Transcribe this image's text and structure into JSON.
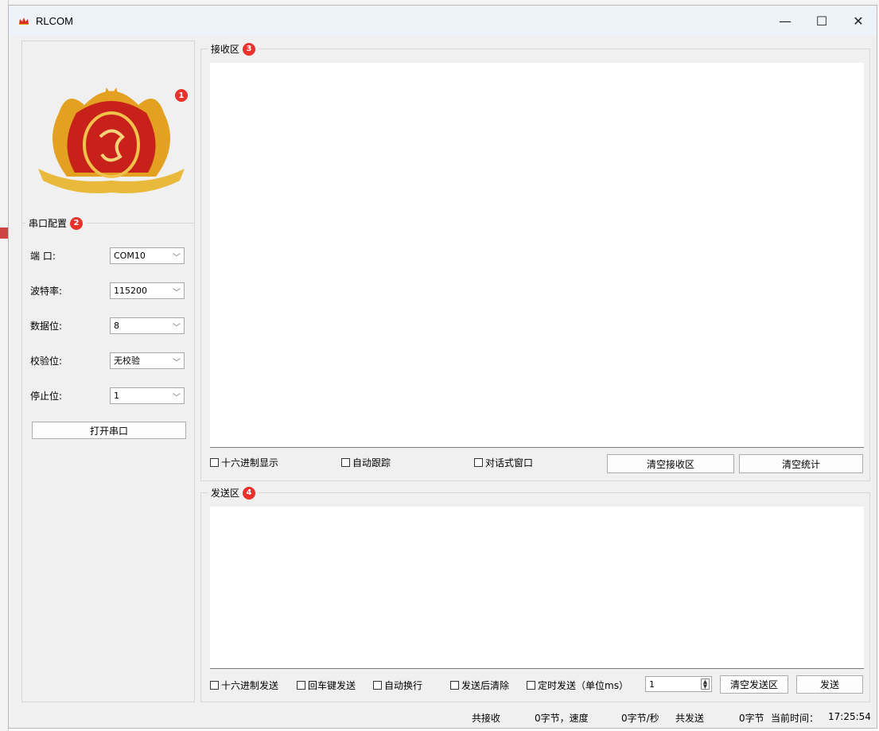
{
  "window": {
    "title": "RLCOM",
    "minimize": "—",
    "maximize": "☐",
    "close": "✕"
  },
  "logo": {
    "badge": "1"
  },
  "serial_config": {
    "title": "串口配置",
    "badge": "2",
    "rows": [
      {
        "label": "端  口:",
        "value": "COM10"
      },
      {
        "label": "波特率:",
        "value": "115200"
      },
      {
        "label": "数据位:",
        "value": "8"
      },
      {
        "label": "校验位:",
        "value": "无校验"
      },
      {
        "label": "停止位:",
        "value": "1"
      }
    ],
    "open_button": "打开串口"
  },
  "receive": {
    "title": "接收区",
    "badge": "3",
    "hex_display": "十六进制显示",
    "auto_follow": "自动跟踪",
    "dialog_window": "对话式窗口",
    "clear_receive": "清空接收区",
    "clear_stats": "清空统计"
  },
  "send": {
    "title": "发送区",
    "badge": "4",
    "hex_send": "十六进制发送",
    "enter_send": "回车键发送",
    "auto_newline": "自动换行",
    "clear_after_send": "发送后清除",
    "timed_send": "定时发送（单位ms）",
    "interval_value": "1",
    "clear_send": "清空发送区",
    "send_button": "发送"
  },
  "status": {
    "received_label": "共接收",
    "received_value": "0字节，速度",
    "speed_value": "0字节/秒",
    "sent_label": "共发送",
    "sent_value": "0字节",
    "time_label": "当前时间：",
    "time_value": "17:25:54"
  },
  "colors": {
    "badge": "#e8322b",
    "titlebar": "#eef3f9",
    "window_bg": "#f0f0f0"
  }
}
